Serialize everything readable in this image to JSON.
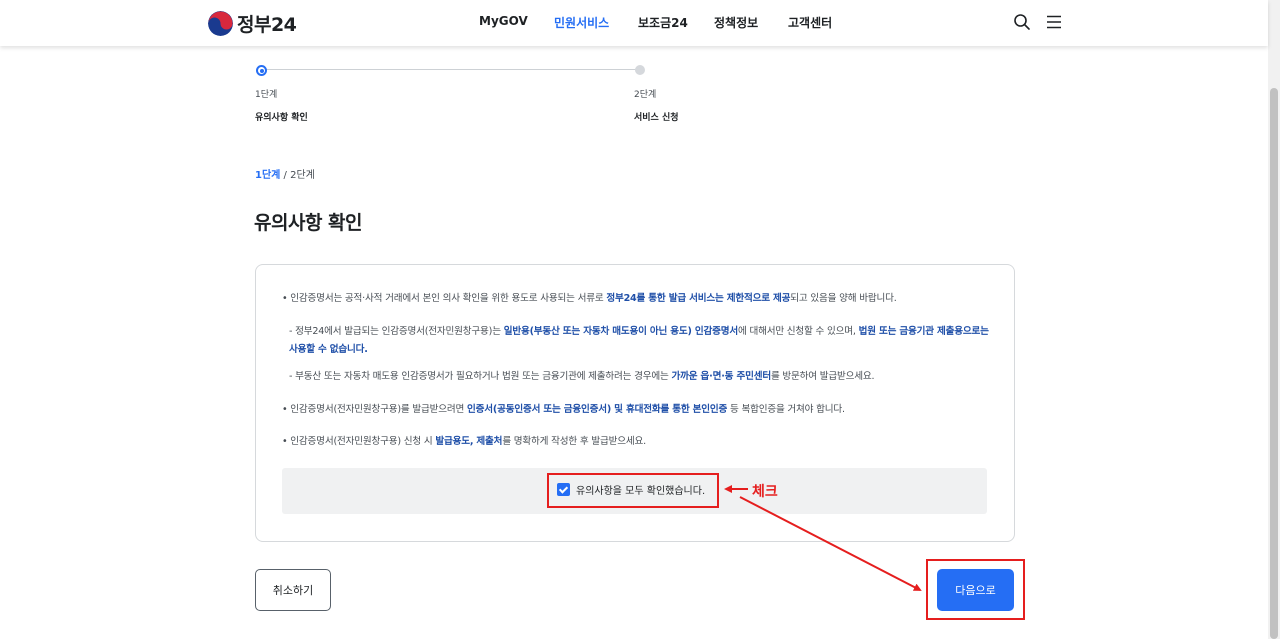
{
  "header": {
    "logo_text": "정부24",
    "nav": [
      "MyGOV",
      "민원서비스",
      "보조금24",
      "정책정보",
      "고객센터"
    ],
    "active_nav": "민원서비스",
    "icons": [
      "search-icon",
      "menu-icon"
    ]
  },
  "stepper": {
    "steps": [
      {
        "no": "1단계",
        "name": "유의사항 확인"
      },
      {
        "no": "2단계",
        "name": "서비스 신청"
      }
    ]
  },
  "breadcrumb": {
    "current": "1단계",
    "separator": "/",
    "next": "2단계"
  },
  "page_title": "유의사항 확인",
  "notice": {
    "item1": {
      "t1": "• 인감증명서는 공적·사적 거래에서 본인 의사 확인을 위한 용도로 사용되는 서류로 ",
      "b1": "정부24를 통한 발급 서비스는 제한적으로 제공",
      "t2": "되고 있음을 양해 바랍니다."
    },
    "sub1": {
      "t1": "- 정부24에서 발급되는 인감증명서(전자민원창구용)는 ",
      "b1": "일반용(부동산 또는 자동차 매도용이 아닌 용도) 인감증명서",
      "t2": "에 대해서만 신청할 수 있으며, ",
      "b2": "법원 또는 금융기관 제출용으로는 사용할 수 없습니다."
    },
    "sub2": {
      "t1": "- 부동산 또는 자동차 매도용 인감증명서가 필요하거나 법원 또는 금융기관에 제출하려는 경우에는 ",
      "b1": "가까운 읍·면·동 주민센터",
      "t2": "를 방문하여 발급받으세요."
    },
    "item2": {
      "t1": "• 인감증명서(전자민원창구용)를 발급받으려면 ",
      "b1": "인증서(공동인증서 또는 금융인증서) 및 휴대전화를 통한 본인인증",
      "t2": " 등 복합인증을 거쳐야 합니다."
    },
    "item3": {
      "t1": "• 인감증명서(전자민원창구용) 신청 시 ",
      "b1": "발급용도, 제출처",
      "t2": "를 명확하게 작성한 후 발급받으세요."
    },
    "checkbox_label": "유의사항을 모두 확인했습니다.",
    "checked": true
  },
  "buttons": {
    "cancel": "취소하기",
    "next": "다음으로"
  },
  "annotation": {
    "label": "체크",
    "color": "#e51e1e"
  },
  "colors": {
    "primary": "#256ef4",
    "emphasis": "#1f4fa8",
    "text": "#1e2124"
  }
}
